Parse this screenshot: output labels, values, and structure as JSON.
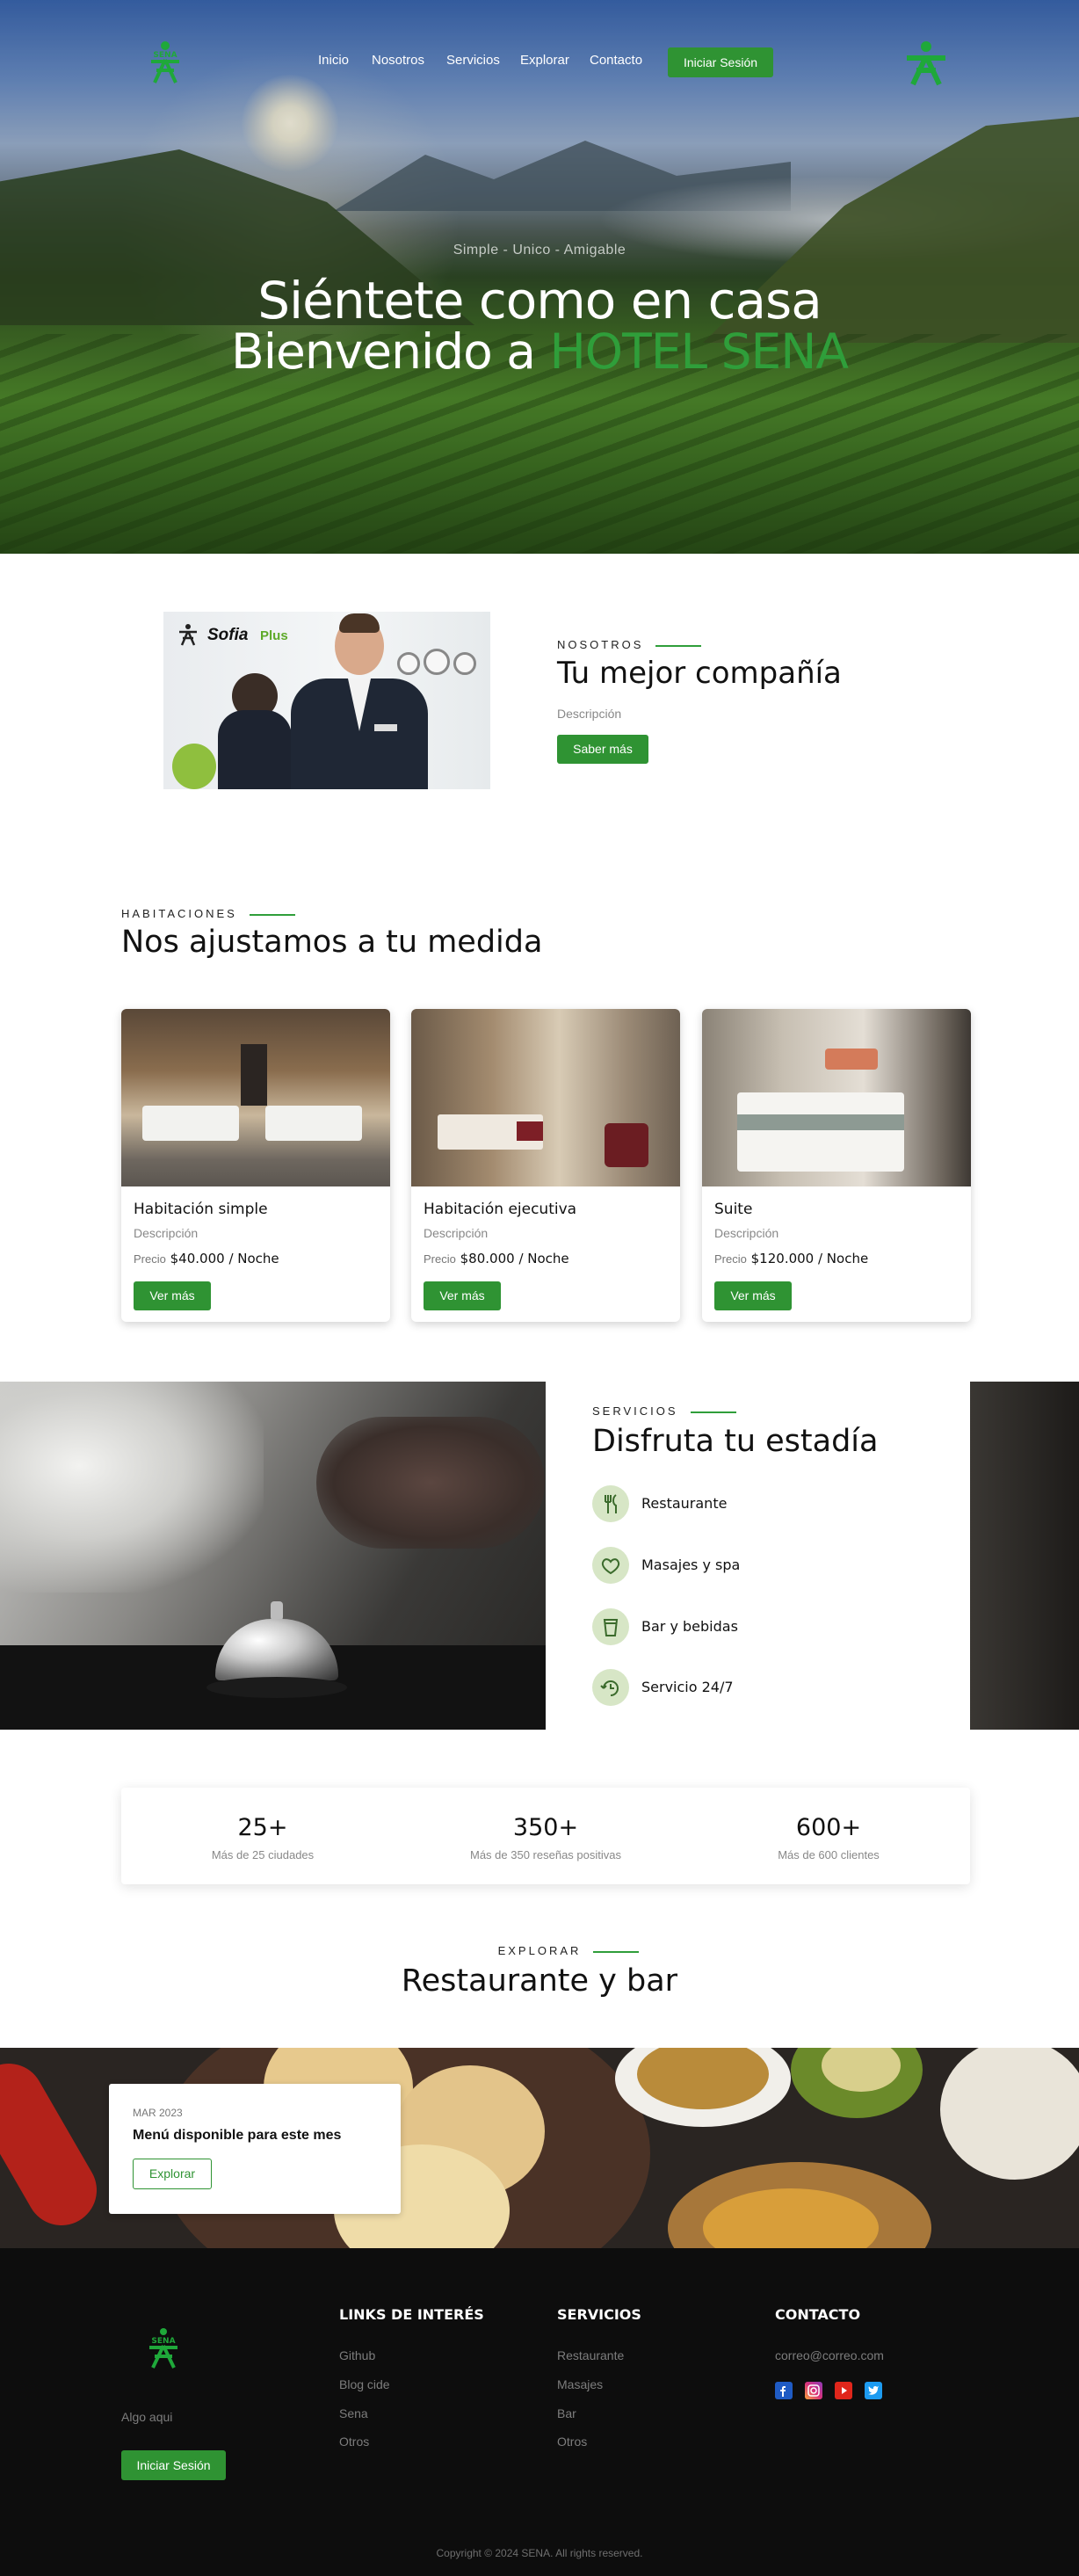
{
  "nav": {
    "items": [
      "Inicio",
      "Nosotros",
      "Servicios",
      "Explorar",
      "Contacto"
    ],
    "login_label": "Iniciar Sesión",
    "logo_text": "SENA"
  },
  "hero": {
    "tagline": "Simple - Unico - Amigable",
    "title_line1": "Siéntete como en casa",
    "title_line2_prefix": "Bienvenido a ",
    "title_line2_highlight": "HOTEL SENA"
  },
  "about": {
    "eyebrow": "NOSOTROS",
    "title": "Tu mejor compañía",
    "description": "Descripción",
    "button": "Saber más",
    "image_brand": "Sofia",
    "image_brand_plus": "Plus"
  },
  "rooms": {
    "eyebrow": "HABITACIONES",
    "title": "Nos ajustamos a tu medida",
    "price_label": "Precio",
    "button": "Ver más",
    "cards": [
      {
        "title": "Habitación simple",
        "description": "Descripción",
        "price": "$40.000 / Noche"
      },
      {
        "title": "Habitación ejecutiva",
        "description": "Descripción",
        "price": "$80.000 / Noche"
      },
      {
        "title": "Suite",
        "description": "Descripción",
        "price": "$120.000 / Noche"
      }
    ]
  },
  "services": {
    "eyebrow": "SERVICIOS",
    "title": "Disfruta tu estadía",
    "items": [
      {
        "label": "Restaurante",
        "icon": "utensils-icon"
      },
      {
        "label": "Masajes y spa",
        "icon": "spa-icon"
      },
      {
        "label": "Bar y bebidas",
        "icon": "drink-icon"
      },
      {
        "label": "Servicio 24/7",
        "icon": "service-24-icon"
      }
    ]
  },
  "stats": [
    {
      "value": "25+",
      "label": "Más de 25 ciudades"
    },
    {
      "value": "350+",
      "label": "Más de 350 reseñas positivas"
    },
    {
      "value": "600+",
      "label": "Más de 600 clientes"
    }
  ],
  "explore": {
    "eyebrow": "EXPLORAR",
    "title": "Restaurante y bar",
    "card_date": "MAR 2023",
    "card_title": "Menú disponible para este mes",
    "card_button": "Explorar"
  },
  "footer": {
    "logo_text": "SENA",
    "tagline": "Algo aqui",
    "login_label": "Iniciar Sesión",
    "links_title": "LINKS DE INTERÉS",
    "links": [
      "Github",
      "Blog cide",
      "Sena",
      "Otros"
    ],
    "services_title": "SERVICIOS",
    "services": [
      "Restaurante",
      "Masajes",
      "Bar",
      "Otros"
    ],
    "contact_title": "CONTACTO",
    "email": "correo@correo.com",
    "social": [
      "facebook-icon",
      "instagram-icon",
      "youtube-icon",
      "twitter-icon"
    ],
    "copyright": "Copyright © 2024 SENA. All rights reserved."
  },
  "colors": {
    "accent": "#2f9333",
    "highlight": "#2f9e3a",
    "footer_bg": "#0d0d0d",
    "icon_bg": "#d7e6c6"
  }
}
